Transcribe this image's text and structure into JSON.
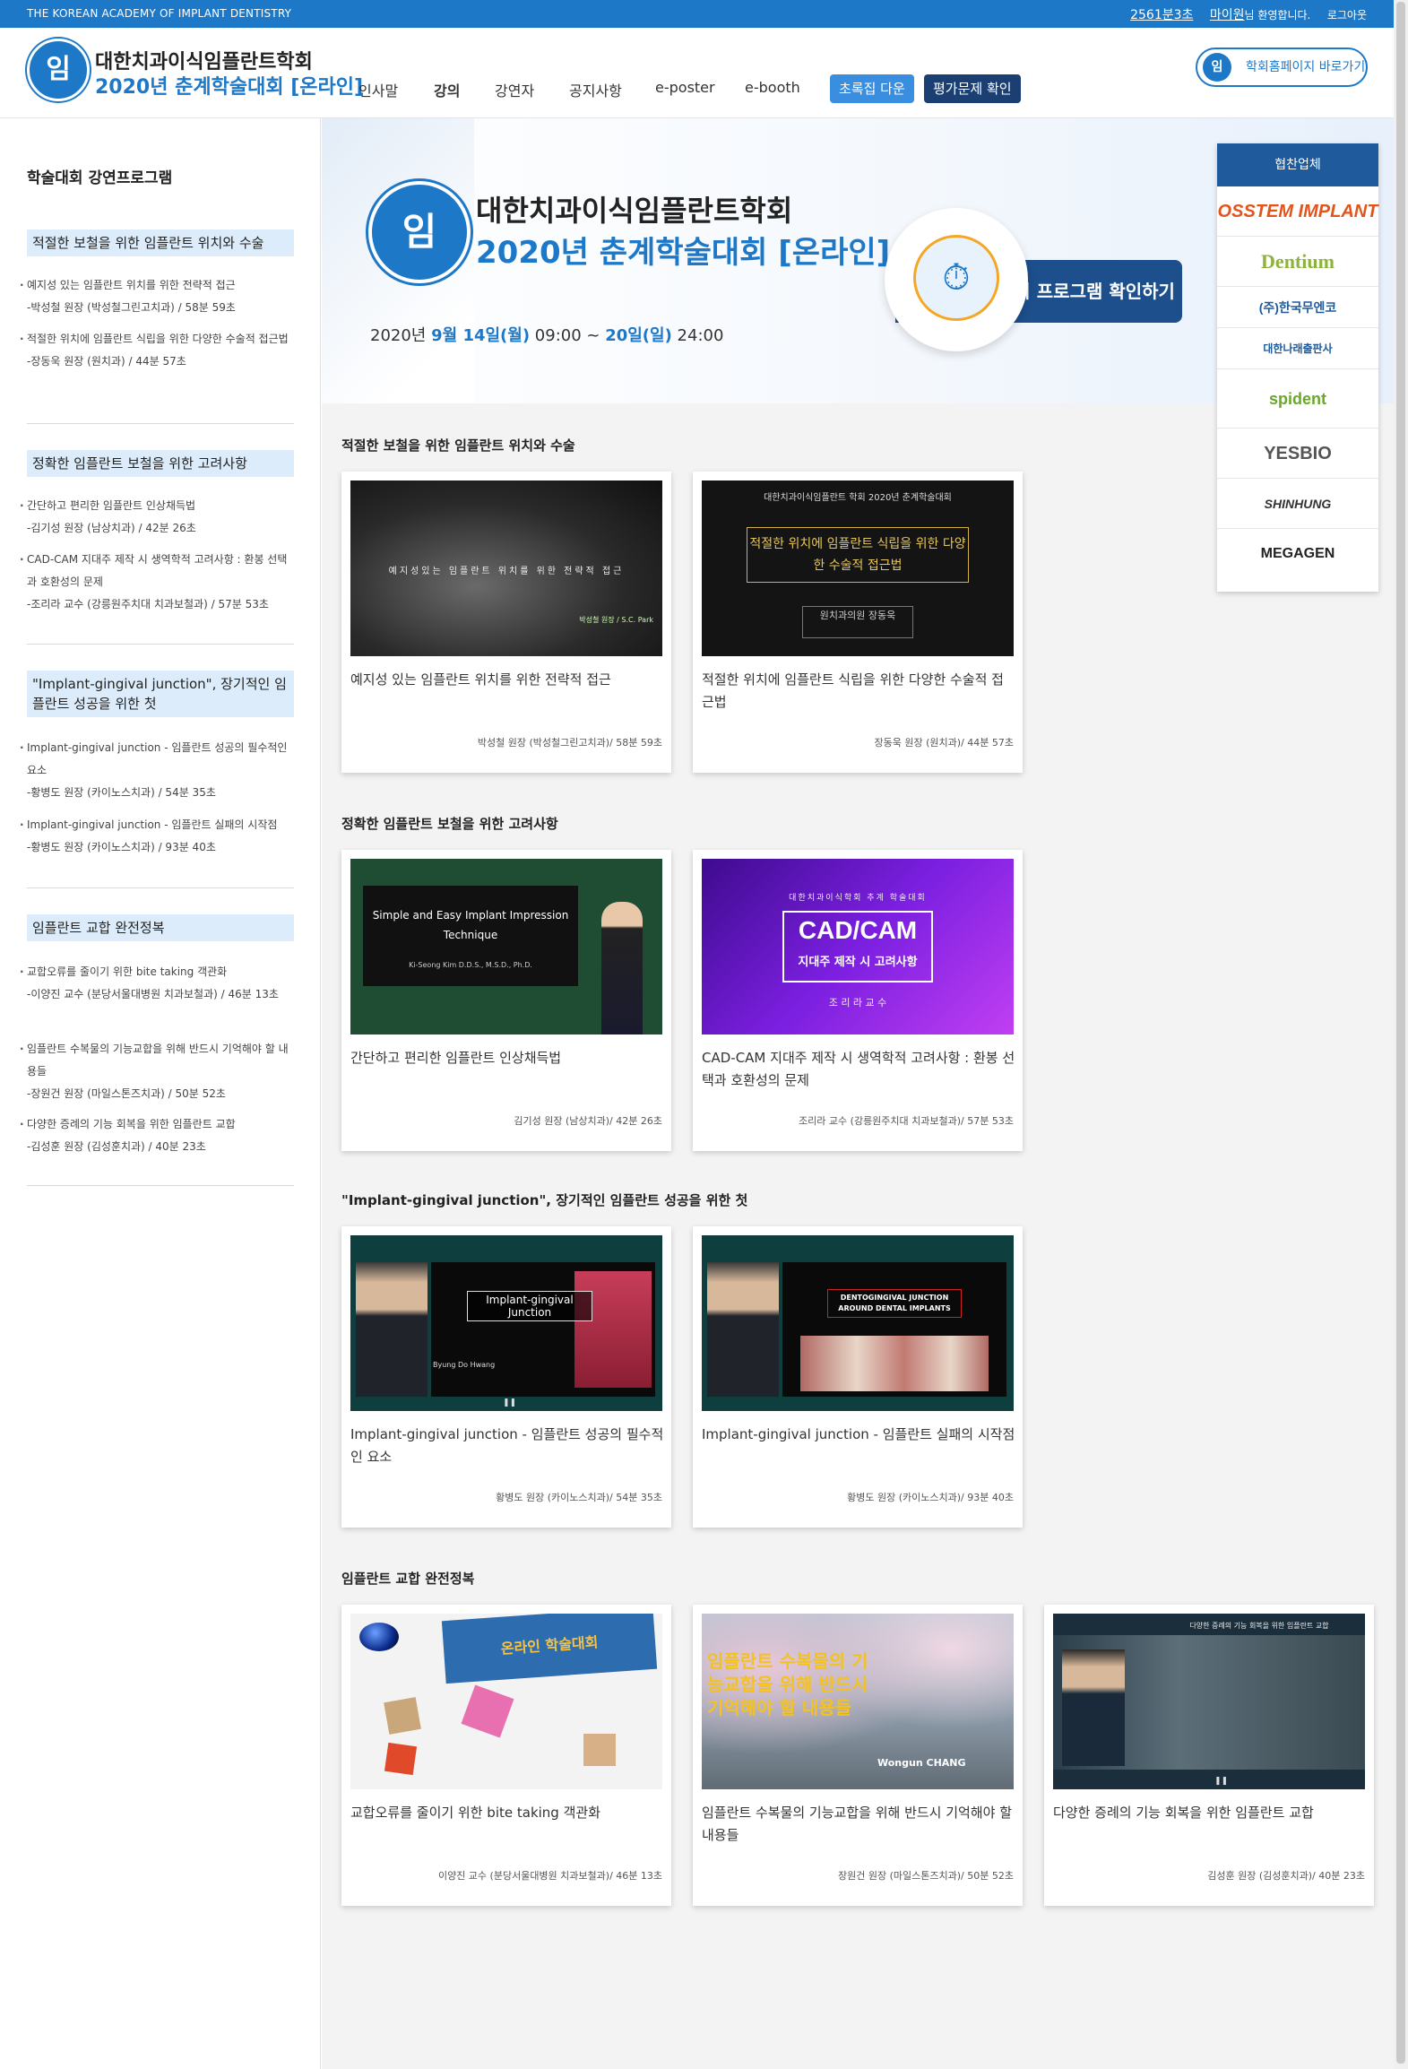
{
  "topbar": {
    "academy": "THE KOREAN ACADEMY OF IMPLANT DENTISTRY",
    "timer": "2561분3초",
    "user_name": "마이원",
    "welcome": "님 환영합니다.",
    "logout": "로그아웃"
  },
  "header": {
    "logo_line1": "대한치과이식임플란트학회",
    "logo_line2": "2020년 춘계학술대회 [온라인]",
    "nav": [
      "인사말",
      "강의",
      "강연자",
      "공지사항",
      "e-poster",
      "e-booth"
    ],
    "btn_abstract": "초록집 다운",
    "btn_quiz": "평가문제 확인",
    "home_link": "학회홈페이지 바로가기"
  },
  "sidebar": {
    "title": "학술대회 강연프로그램",
    "sections": [
      {
        "heading": "적절한 보철을 위한 임플란트 위치와 수술",
        "items": [
          {
            "title": "예지성 있는 임플란트 위치를 위한 전략적 접근",
            "speaker": "-박성철 원장 (박성철그린고치과) / 58분 59초"
          },
          {
            "title": "적절한 위치에 임플란트 식립을 위한 다양한 수술적 접근법",
            "speaker": "-장동욱 원장 (원치과) / 44분 57초"
          }
        ]
      },
      {
        "heading": "정확한 임플란트 보철을 위한 고려사항",
        "items": [
          {
            "title": "간단하고 편리한 임플란트 인상채득법",
            "speaker": "-김기성 원장 (남상치과) / 42분 26초"
          },
          {
            "title": "CAD-CAM 지대주 제작 시 생역학적 고려사항 : 환봉 선택과 호환성의 문제",
            "speaker": "-조리라 교수 (강릉원주치대 치과보철과) / 57분 53초"
          }
        ]
      },
      {
        "heading": "\"Implant-gingival junction\", 장기적인 임플란트 성공을 위한 첫",
        "items": [
          {
            "title": "Implant-gingival junction - 임플란트 성공의 필수적인 요소",
            "speaker": "-황병도 원장 (카이노스치과) / 54분 35초"
          },
          {
            "title": "Implant-gingival junction - 임플란트 실패의 시작점",
            "speaker": "-황병도 원장 (카이노스치과) / 93분 40초"
          }
        ]
      },
      {
        "heading": "임플란트 교합 완전정복",
        "items": [
          {
            "title": "교합오류를 줄이기 위한 bite taking 객관화",
            "speaker": "-이양진 교수 (분당서울대병원 치과보철과) / 46분 13초"
          },
          {
            "title": "임플란트 수복물의 기능교합을 위해 반드시 기억해야 할 내용들",
            "speaker": "-장원건 원장 (마일스톤즈치과) / 50분 52초"
          },
          {
            "title": "다양한 증례의 기능 회복을 위한 임플란트 교합",
            "speaker": "-김성훈 원장 (김성훈치과) / 40분 23초"
          }
        ]
      }
    ]
  },
  "banner": {
    "line1": "대한치과이식임플란트학회",
    "line2": "2020년 춘계학술대회 [온라인]",
    "date_prefix": "2020년 ",
    "date_start": "9월 14일(월)",
    "date_mid": " 09:00 ~ ",
    "date_end": "20일(일)",
    "date_suffix": " 24:00",
    "cta": "강의 프로그램 확인하기"
  },
  "sponsors": {
    "heading": "협찬업체",
    "items": [
      {
        "name": "OSSTEM IMPLANT",
        "color": "#e2541b"
      },
      {
        "name": "Dentium",
        "color": "#8cb33a"
      },
      {
        "name": "(주)한국무엔코",
        "color": "#1e5a9c"
      },
      {
        "name": "대한나래출판사",
        "color": "#1e5a9c"
      },
      {
        "name": "spident",
        "color": "#6aa829"
      },
      {
        "name": "YESBIO",
        "color": "#555555"
      },
      {
        "name": "SHINHUNG",
        "color": "#333333"
      },
      {
        "name": "MEGAGEN",
        "color": "#222222"
      }
    ]
  },
  "main": {
    "sections": [
      {
        "title": "적절한 보철을 위한 임플란트 위치와 수술",
        "cards": [
          {
            "title": "예지성 있는 임플란트 위치를 위한 전략적 접근",
            "meta": "박성철 원장 (박성철그린고치과)/ 58분 59초",
            "slide_top": "예지성있는 임플란트 위치를 위한 전략적 접근",
            "slide_bottom": "박성철 원장 / S.C. Park"
          },
          {
            "title": "적절한 위치에 임플란트 식립을 위한 다양한 수술적 접근법",
            "meta": "장동욱 원장 (원치과)/ 44분 57초",
            "slide_top": "대한치과이식임플란트 학회 2020년 춘계학술대회",
            "slide_main": "적절한 위치에 임플란트 식립을 위한 다양한 수술적 접근법",
            "slide_bottom": "원치과의원 장동욱"
          }
        ]
      },
      {
        "title": "정확한 임플란트 보철을 위한 고려사항",
        "cards": [
          {
            "title": "간단하고 편리한 임플란트 인상채득법",
            "meta": "김기성 원장 (남상치과)/ 42분 26초",
            "slide_main": "Simple and Easy Implant Impression Technique",
            "slide_bottom": "Ki-Seong Kim  D.D.S., M.S.D., Ph.D."
          },
          {
            "title": "CAD-CAM 지대주 제작 시 생역학적 고려사항 : 환봉 선택과 호환성의 문제",
            "meta": "조리라 교수 (강릉원주치대 치과보철과)/ 57분 53초",
            "slide_top": "대한치과이식학회 추계 학술대회",
            "slide_main": "CAD/CAM",
            "slide_sub": "지대주 제작 시 고려사항",
            "slide_bottom": "조 리 라 교 수"
          }
        ]
      },
      {
        "title": "\"Implant-gingival junction\", 장기적인 임플란트 성공을 위한 첫",
        "cards": [
          {
            "title": "Implant-gingival junction - 임플란트 성공의 필수적인 요소",
            "meta": "황병도 원장 (카이노스치과)/ 54분 35초",
            "slide_main": "Implant-gingival Junction",
            "slide_bottom": "Byung Do Hwang"
          },
          {
            "title": "Implant-gingival junction - 임플란트 실패의 시작점",
            "meta": "황병도 원장 (카이노스치과)/ 93분 40초",
            "slide_main": "DENTOGINGIVAL JUNCTION AROUND DENTAL IMPLANTS"
          }
        ]
      },
      {
        "title": "임플란트 교합 완전정복",
        "cards": [
          {
            "title": "교합오류를 줄이기 위한 bite taking 객관화",
            "meta": "이양진 교수 (분당서울대병원 치과보철과)/ 46분 13초",
            "slide_main": "온라인 학술대회"
          },
          {
            "title": "임플란트 수복물의 기능교합을 위해 반드시 기억해야 할 내용들",
            "meta": "장원건 원장 (마일스톤즈치과)/ 50분 52초",
            "slide_main": "임플란트 수복물의 기능교합을 위해 반드시 기억해야 할 내용들",
            "slide_bottom": "Wongun CHANG"
          },
          {
            "title": "다양한 증례의 기능 회복을 위한 임플란트 교합",
            "meta": "김성훈 원장 (김성훈치과)/ 40분 23초",
            "slide_main": "다양한 증례의 기능 회복을 위한 임플란트 교합"
          }
        ]
      }
    ]
  }
}
